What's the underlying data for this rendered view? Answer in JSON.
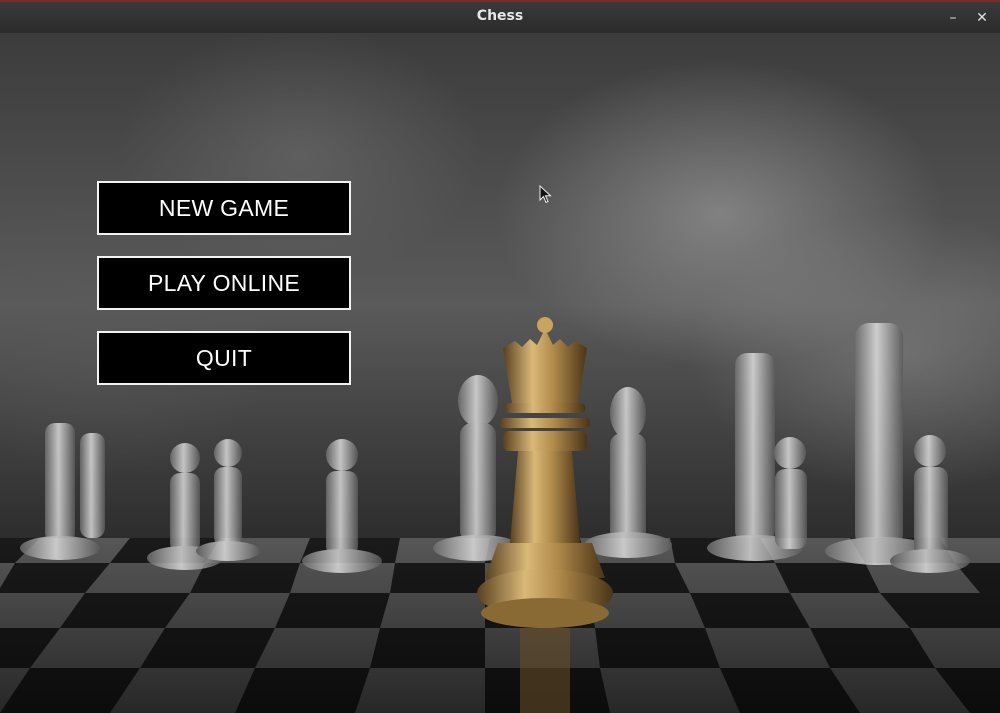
{
  "window": {
    "title": "Chess",
    "minimize_glyph": "–",
    "close_glyph": "✕"
  },
  "menu": {
    "items": [
      {
        "label": "NEW GAME"
      },
      {
        "label": "PLAY ONLINE"
      },
      {
        "label": "QUIT"
      }
    ]
  },
  "background": {
    "description_icon": "chess-board-photo",
    "colors": {
      "queen_gold": "#b08a4a",
      "piece_silver": "#c8c8c8",
      "button_bg": "#000000",
      "button_border": "#f2f2f2"
    }
  },
  "cursor": {
    "icon": "arrow-pointer-icon"
  }
}
